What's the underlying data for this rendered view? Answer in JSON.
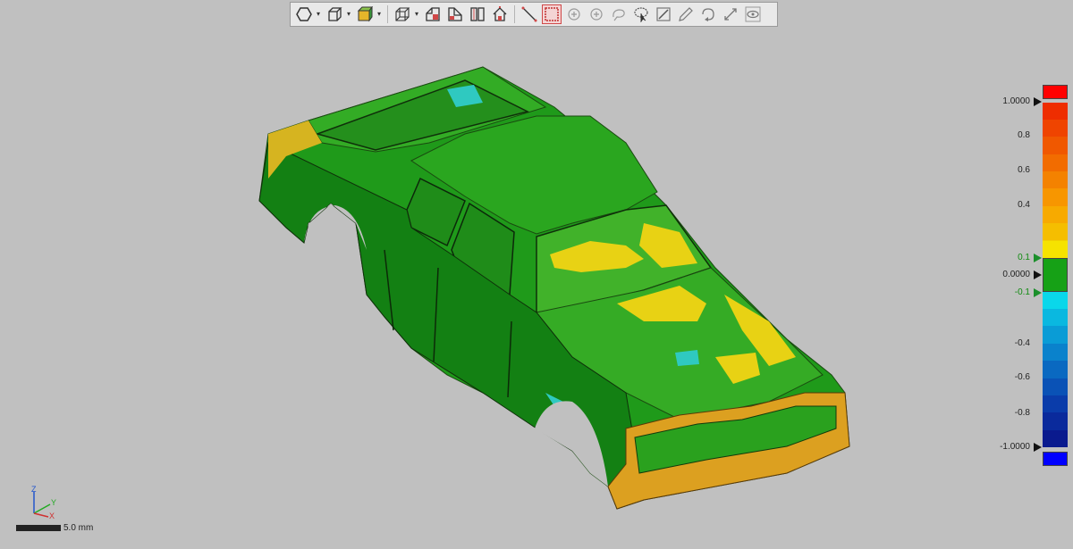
{
  "toolbar": {
    "buttons": [
      {
        "icon": "polygon-view-icon"
      },
      {
        "icon": "wireframe-box-icon"
      },
      {
        "icon": "shaded-box-icon"
      },
      {
        "icon": "iso-view-icon"
      },
      {
        "icon": "front-view-icon"
      },
      {
        "icon": "side-view-icon"
      },
      {
        "icon": "split-view-icon"
      },
      {
        "icon": "house-view-icon"
      },
      {
        "icon": "line-measure-icon"
      },
      {
        "icon": "select-box-icon"
      },
      {
        "icon": "add-point-icon"
      },
      {
        "icon": "add-circle-icon"
      },
      {
        "icon": "lasso-icon"
      },
      {
        "icon": "pointer-select-icon"
      },
      {
        "icon": "section-icon"
      },
      {
        "icon": "annotate-icon"
      },
      {
        "icon": "rotate-icon"
      },
      {
        "icon": "transform-icon"
      },
      {
        "icon": "eye-icon"
      }
    ]
  },
  "color_scale": {
    "colors": [
      "#ff0000",
      "#ee2d00",
      "#ef4400",
      "#f05800",
      "#f26c00",
      "#f48200",
      "#f79600",
      "#f7aa00",
      "#f5be00",
      "#f1d200",
      "#f6e300",
      "#16a116",
      "#0ad7ea",
      "#0ab8e0",
      "#0a9cd6",
      "#0a82cc",
      "#0a69c1",
      "#0a52b6",
      "#0a3caa",
      "#0a2a9c",
      "#0a1a8e",
      "#0000ff"
    ],
    "labels": [
      {
        "text": "1.0000",
        "color": "dark",
        "marker": true
      },
      {
        "text": "0.8",
        "color": "dark",
        "marker": false
      },
      {
        "text": "0.6",
        "color": "dark",
        "marker": false
      },
      {
        "text": "0.4",
        "color": "dark",
        "marker": false
      },
      {
        "text": "0.1",
        "color": "green",
        "marker": true
      },
      {
        "text": "0.0000",
        "color": "dark",
        "marker": true
      },
      {
        "text": "-0.1",
        "color": "green",
        "marker": true
      },
      {
        "text": "-0.4",
        "color": "dark",
        "marker": false
      },
      {
        "text": "-0.6",
        "color": "dark",
        "marker": false
      },
      {
        "text": "-0.8",
        "color": "dark",
        "marker": false
      },
      {
        "text": "-1.0000",
        "color": "dark",
        "marker": true
      }
    ]
  },
  "triad": {
    "z": "Z",
    "y": "Y",
    "x": "X"
  },
  "scalebar": {
    "label": "5.0 mm"
  }
}
